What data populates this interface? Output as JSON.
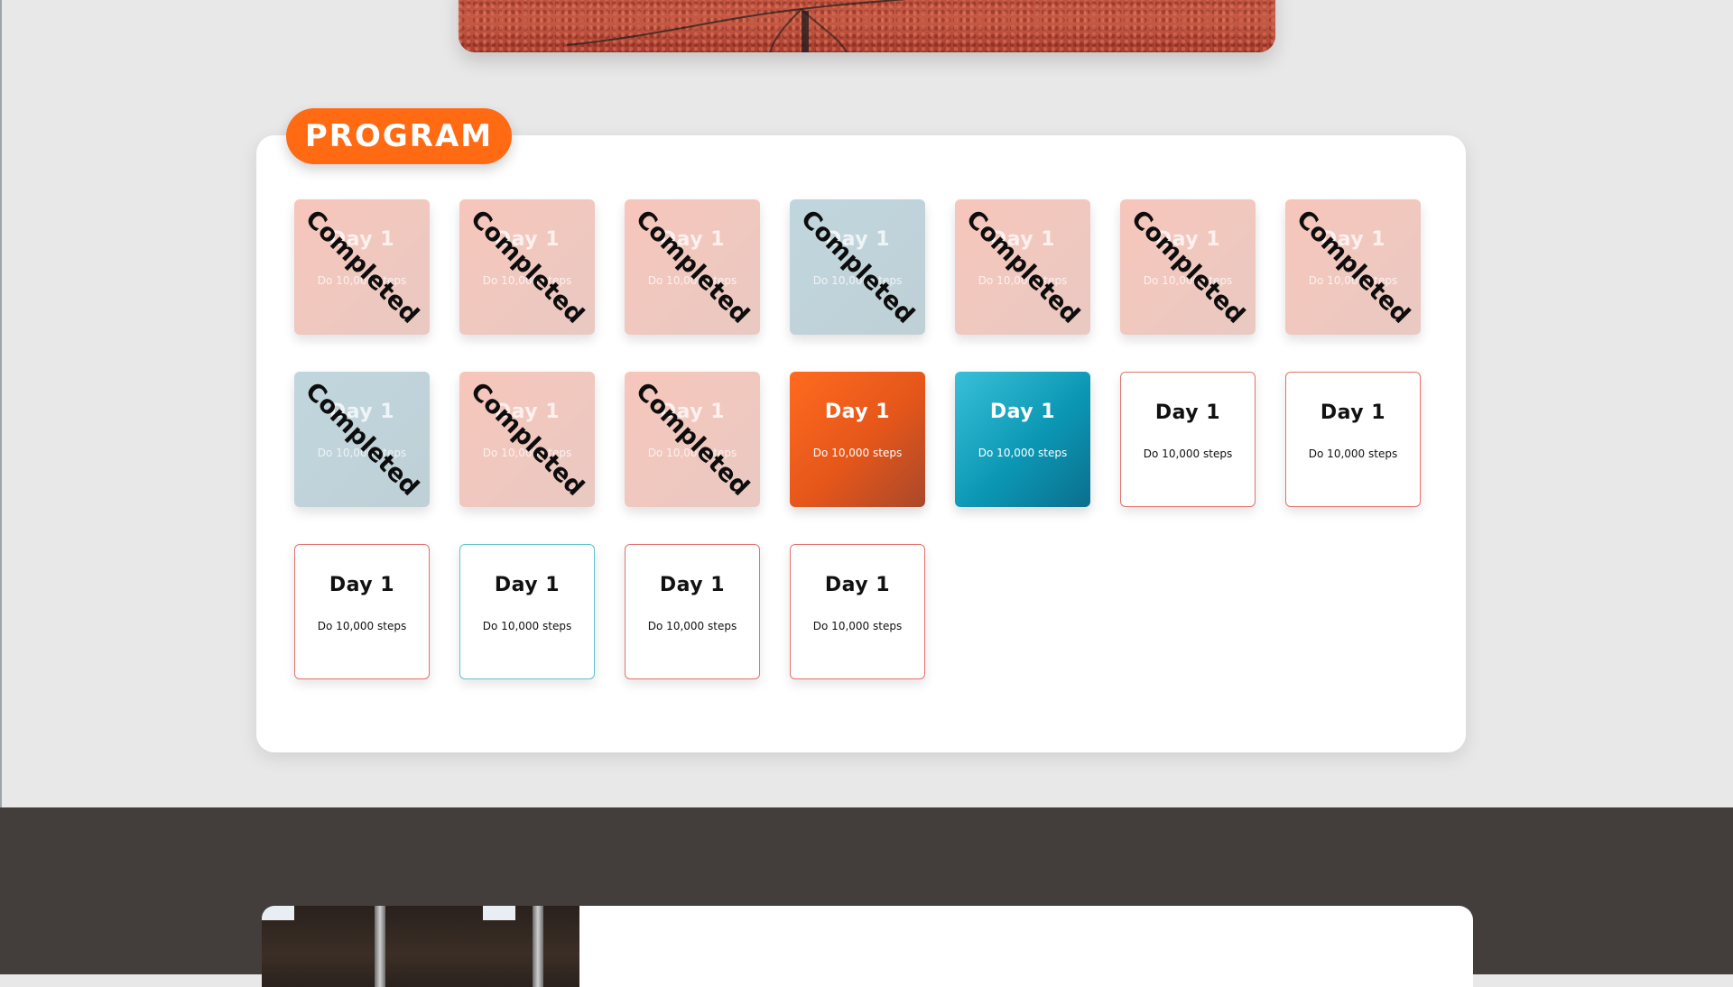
{
  "program": {
    "badge_label": "PROGRAM",
    "completed_label": "Completed",
    "days": [
      {
        "title": "Day 1",
        "task": "Do 10,000 steps",
        "status": "completed",
        "tint": "pink"
      },
      {
        "title": "Day 1",
        "task": "Do 10,000 steps",
        "status": "completed",
        "tint": "pink"
      },
      {
        "title": "Day 1",
        "task": "Do 10,000 steps",
        "status": "completed",
        "tint": "pink"
      },
      {
        "title": "Day 1",
        "task": "Do 10,000 steps",
        "status": "completed",
        "tint": "blue"
      },
      {
        "title": "Day 1",
        "task": "Do 10,000 steps",
        "status": "completed",
        "tint": "pink"
      },
      {
        "title": "Day 1",
        "task": "Do 10,000 steps",
        "status": "completed",
        "tint": "pink"
      },
      {
        "title": "Day 1",
        "task": "Do 10,000 steps",
        "status": "completed",
        "tint": "pink"
      },
      {
        "title": "Day 1",
        "task": "Do 10,000 steps",
        "status": "completed",
        "tint": "blue"
      },
      {
        "title": "Day 1",
        "task": "Do 10,000 steps",
        "status": "completed",
        "tint": "pink"
      },
      {
        "title": "Day 1",
        "task": "Do 10,000 steps",
        "status": "completed",
        "tint": "pink"
      },
      {
        "title": "Day 1",
        "task": "Do 10,000 steps",
        "status": "current",
        "tint": "orange"
      },
      {
        "title": "Day 1",
        "task": "Do 10,000 steps",
        "status": "current",
        "tint": "teal"
      },
      {
        "title": "Day 1",
        "task": "Do 10,000 steps",
        "status": "upcoming",
        "tint": "orange"
      },
      {
        "title": "Day 1",
        "task": "Do 10,000 steps",
        "status": "upcoming",
        "tint": "orange"
      },
      {
        "title": "Day 1",
        "task": "Do 10,000 steps",
        "status": "upcoming",
        "tint": "orange"
      },
      {
        "title": "Day 1",
        "task": "Do 10,000 steps",
        "status": "upcoming",
        "tint": "teal"
      },
      {
        "title": "Day 1",
        "task": "Do 10,000 steps",
        "status": "upcoming",
        "tint": "orange"
      },
      {
        "title": "Day 1",
        "task": "Do 10,000 steps",
        "status": "upcoming",
        "tint": "orange"
      }
    ]
  },
  "colors": {
    "accent_orange": "#ff6a13",
    "accent_teal": "#0b97b4",
    "page_background": "#e8e8e8",
    "dark_section": "#433e3c"
  }
}
